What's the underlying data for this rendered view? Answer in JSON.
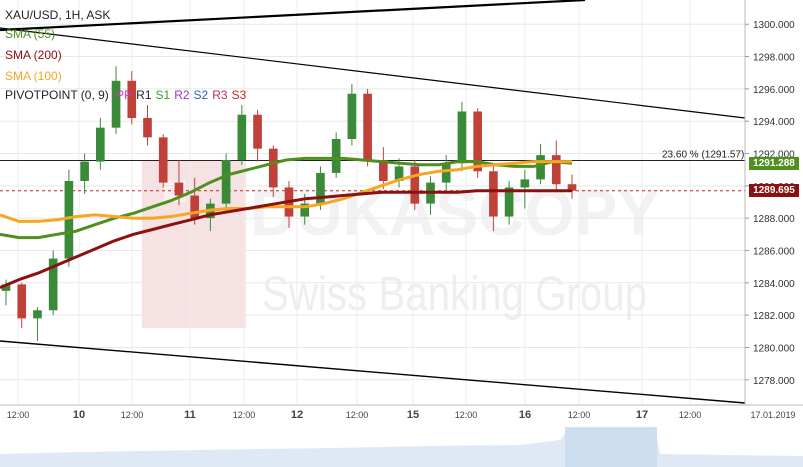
{
  "header": {
    "title": "XAU/USD, 1H, ASK"
  },
  "legend": {
    "sma55": "SMA (55)",
    "sma200": "SMA (200)",
    "sma100": "SMA (100)",
    "pivot_prefix": "PIVOTPOINT (0, 9)",
    "pivot_items": [
      {
        "label": "PP",
        "color": "#c03cc0"
      },
      {
        "label": "R1",
        "color": "#222222"
      },
      {
        "label": "S1",
        "color": "#3c9a2a"
      },
      {
        "label": "R2",
        "color": "#9c36b8"
      },
      {
        "label": "S2",
        "color": "#2a62c0"
      },
      {
        "label": "R3",
        "color": "#b03060"
      },
      {
        "label": "S3",
        "color": "#c02828"
      }
    ]
  },
  "watermark": {
    "brand": "DUKASCOPY",
    "sub": "Swiss Banking Group"
  },
  "price_labels": {
    "sma55": "1291.288",
    "current": "1289.695",
    "fib": "23.60 % (1291.57)"
  },
  "colors": {
    "sma55": "#4f8f1f",
    "sma200": "#8b1010",
    "sma100": "#f5a623",
    "candle_up": "#3a8a3a",
    "candle_down": "#c0403a",
    "channel": "#000000",
    "dashed": "#c02828"
  },
  "chart_data": {
    "type": "candlestick",
    "symbol": "XAU/USD",
    "timeframe": "1H",
    "ylim": [
      1276.5,
      1301.5
    ],
    "y_ticks": [
      1278.0,
      1280.0,
      1282.0,
      1284.0,
      1286.0,
      1288.0,
      1290.0,
      1292.0,
      1294.0,
      1296.0,
      1298.0,
      1300.0
    ],
    "x_ticks": [
      "12:00",
      "10",
      "12:00",
      "11",
      "12:00",
      "12",
      "12:00",
      "15",
      "12:00",
      "16",
      "12:00",
      "17",
      "12:00",
      "17.01.2019"
    ],
    "fib_level": 1291.57,
    "current_price": 1289.695,
    "sma55_value": 1291.288,
    "series": [
      {
        "name": "SMA (55)",
        "values": [
          1287.0,
          1286.8,
          1286.8,
          1287.0,
          1287.2,
          1287.6,
          1288.0,
          1288.3,
          1288.7,
          1289.1,
          1289.6,
          1290.2,
          1290.7,
          1291.0,
          1291.3,
          1291.6,
          1291.7,
          1291.7,
          1291.7,
          1291.6,
          1291.5,
          1291.4,
          1291.3,
          1291.3,
          1291.5,
          1291.5,
          1291.3,
          1291.2,
          1291.2,
          1291.5,
          1291.4
        ]
      },
      {
        "name": "SMA (100)",
        "values": [
          1288.2,
          1287.8,
          1287.8,
          1287.9,
          1288.1,
          1288.2,
          1288.1,
          1288.0,
          1288.0,
          1288.1,
          1288.3,
          1288.5,
          1288.6,
          1288.6,
          1288.7,
          1288.7,
          1288.7,
          1288.9,
          1289.2,
          1289.6,
          1290.0,
          1290.4,
          1290.7,
          1290.9,
          1291.0,
          1291.2,
          1291.3,
          1291.4,
          1291.5,
          1291.5,
          1291.5
        ]
      },
      {
        "name": "SMA (200)",
        "values": [
          1283.7,
          1284.2,
          1284.6,
          1285.1,
          1285.6,
          1286.1,
          1286.6,
          1287.0,
          1287.3,
          1287.6,
          1287.9,
          1288.2,
          1288.4,
          1288.6,
          1288.8,
          1289.0,
          1289.2,
          1289.3,
          1289.4,
          1289.5,
          1289.6,
          1289.6,
          1289.6,
          1289.6,
          1289.6,
          1289.7,
          1289.7,
          1289.7,
          1289.7,
          1289.7,
          1289.7
        ]
      }
    ],
    "candles": [
      [
        1283.5,
        1284.2,
        1282.6,
        1283.9
      ],
      [
        1283.9,
        1284.0,
        1281.2,
        1281.8
      ],
      [
        1281.8,
        1282.5,
        1280.4,
        1282.3
      ],
      [
        1282.3,
        1286.0,
        1282.0,
        1285.5
      ],
      [
        1285.5,
        1291.0,
        1285.0,
        1290.3
      ],
      [
        1290.3,
        1292.0,
        1289.5,
        1291.5
      ],
      [
        1291.5,
        1294.2,
        1291.0,
        1293.6
      ],
      [
        1293.6,
        1297.4,
        1293.2,
        1296.5
      ],
      [
        1296.5,
        1297.1,
        1293.8,
        1294.2
      ],
      [
        1294.2,
        1295.0,
        1292.5,
        1293.0
      ],
      [
        1293.0,
        1293.2,
        1289.9,
        1290.2
      ],
      [
        1290.2,
        1291.6,
        1288.8,
        1289.4
      ],
      [
        1289.4,
        1290.5,
        1287.6,
        1288.0
      ],
      [
        1288.0,
        1289.2,
        1287.2,
        1288.9
      ],
      [
        1288.9,
        1292.0,
        1288.4,
        1291.6
      ],
      [
        1291.6,
        1295.0,
        1291.3,
        1294.4
      ],
      [
        1294.4,
        1294.7,
        1291.5,
        1292.3
      ],
      [
        1292.3,
        1292.5,
        1289.3,
        1289.9
      ],
      [
        1289.9,
        1290.3,
        1287.4,
        1288.1
      ],
      [
        1288.1,
        1289.5,
        1287.6,
        1288.9
      ],
      [
        1288.9,
        1291.2,
        1288.5,
        1290.8
      ],
      [
        1290.8,
        1293.3,
        1290.5,
        1292.9
      ],
      [
        1292.9,
        1296.3,
        1292.5,
        1295.7
      ],
      [
        1295.7,
        1296.0,
        1291.2,
        1291.6
      ],
      [
        1291.6,
        1292.4,
        1289.8,
        1290.3
      ],
      [
        1290.3,
        1291.7,
        1289.9,
        1291.2
      ],
      [
        1291.2,
        1291.6,
        1288.5,
        1288.9
      ],
      [
        1288.9,
        1290.6,
        1288.2,
        1290.2
      ],
      [
        1290.2,
        1291.9,
        1289.7,
        1291.4
      ],
      [
        1291.4,
        1295.2,
        1290.9,
        1294.6
      ],
      [
        1294.6,
        1294.8,
        1290.5,
        1290.9
      ],
      [
        1290.9,
        1291.2,
        1287.2,
        1288.1
      ],
      [
        1288.1,
        1290.3,
        1287.6,
        1289.9
      ],
      [
        1289.9,
        1291.0,
        1288.6,
        1290.4
      ],
      [
        1290.4,
        1292.6,
        1290.1,
        1291.9
      ],
      [
        1291.9,
        1292.8,
        1289.6,
        1290.1
      ],
      [
        1290.1,
        1290.7,
        1289.2,
        1289.7
      ]
    ]
  }
}
